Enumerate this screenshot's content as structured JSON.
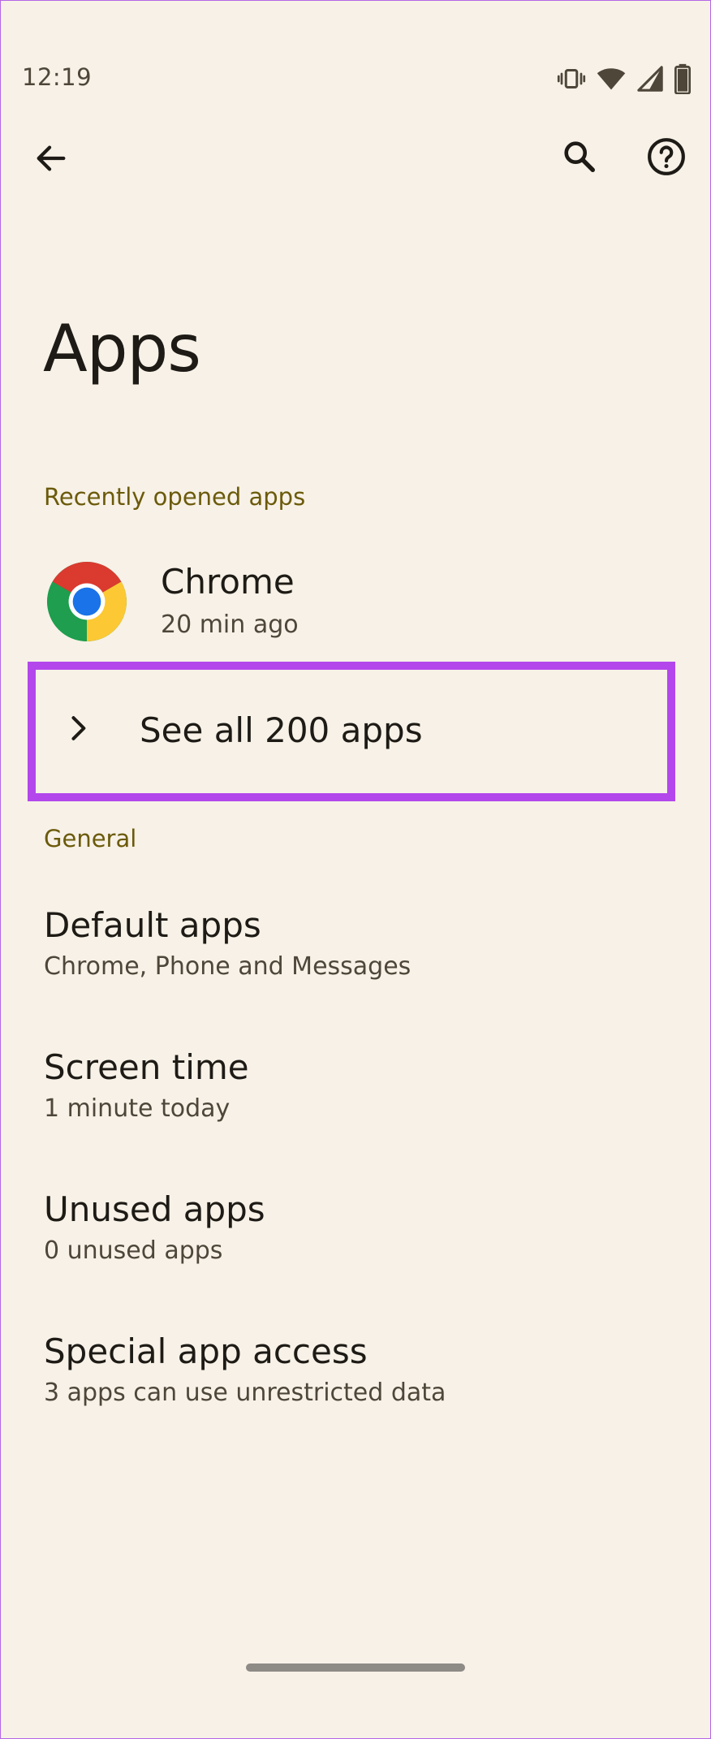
{
  "status_bar": {
    "time": "12:19",
    "icons": [
      "vibrate-icon",
      "wifi-icon",
      "signal-icon",
      "battery-icon"
    ]
  },
  "app_bar": {
    "back_icon": "arrow-back-icon",
    "search_icon": "search-icon",
    "help_icon": "help-icon"
  },
  "page": {
    "title": "Apps"
  },
  "recent": {
    "header": "Recently opened apps",
    "apps": [
      {
        "name": "Chrome",
        "subtitle": "20 min ago",
        "icon": "chrome-icon"
      }
    ],
    "see_all_label": "See all 200 apps"
  },
  "general": {
    "header": "General",
    "items": [
      {
        "title": "Default apps",
        "subtitle": "Chrome, Phone and Messages"
      },
      {
        "title": "Screen time",
        "subtitle": "1 minute today"
      },
      {
        "title": "Unused apps",
        "subtitle": "0 unused apps"
      },
      {
        "title": "Special app access",
        "subtitle": "3 apps can use unrestricted data"
      }
    ]
  },
  "colors": {
    "background": "#f7f1e7",
    "section_header": "#6b5a0a",
    "highlight": "#b347ec"
  }
}
